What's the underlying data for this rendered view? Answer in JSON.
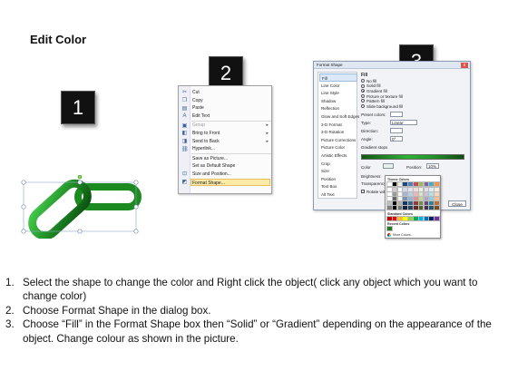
{
  "title": "Edit Color",
  "badges": [
    "1",
    "2",
    "3"
  ],
  "context_menu": {
    "items": [
      {
        "label": "Cut",
        "icon": "scissors-icon",
        "glyph": "✂"
      },
      {
        "label": "Copy",
        "icon": "copy-icon",
        "glyph": "❐"
      },
      {
        "label": "Paste",
        "icon": "paste-icon",
        "glyph": "▤"
      },
      {
        "label": "Edit Text",
        "icon": "edit-text-icon",
        "glyph": "A"
      },
      {
        "label": "Group",
        "icon": "group-icon",
        "glyph": "▣",
        "disabled": true,
        "submenu": true
      },
      {
        "label": "Bring to Front",
        "icon": "bring-front-icon",
        "glyph": "◧",
        "submenu": true
      },
      {
        "label": "Send to Back",
        "icon": "send-back-icon",
        "glyph": "◨",
        "submenu": true
      },
      {
        "label": "Hyperlink...",
        "icon": "hyperlink-icon",
        "glyph": "⛓"
      },
      {
        "label": "Save as Picture...",
        "icon": "",
        "glyph": ""
      },
      {
        "label": "Set as Default Shape",
        "icon": "",
        "glyph": ""
      },
      {
        "label": "Size and Position...",
        "icon": "size-position-icon",
        "glyph": "⊡"
      },
      {
        "label": "Format Shape...",
        "icon": "format-shape-icon",
        "glyph": "◩",
        "highlighted": true
      }
    ]
  },
  "dialog": {
    "title": "Format Shape",
    "close": "x",
    "nav": [
      "Fill",
      "Line Color",
      "Line Style",
      "Shadow",
      "Reflection",
      "Glow and Soft Edges",
      "3-D Format",
      "3-D Rotation",
      "Picture Corrections",
      "Picture Color",
      "Artistic Effects",
      "Crop",
      "Size",
      "Position",
      "Text Box",
      "Alt Text"
    ],
    "section": "Fill",
    "fill_options": [
      "No fill",
      "Solid fill",
      "Gradient fill",
      "Picture or texture fill",
      "Pattern fill",
      "Slide background fill"
    ],
    "selected_fill": "Gradient fill",
    "fields": {
      "preset": "Preset colors:",
      "type": "Type:",
      "type_value": "Linear",
      "direction": "Direction:",
      "angle": "Angle:",
      "angle_value": "0°",
      "gradient_stops": "Gradient stops",
      "color": "Color",
      "position": "Position:",
      "position_value": "10%",
      "brightness": "Brightness:",
      "transparency": "Transparency:",
      "rotate": "Rotate with shape"
    },
    "close_button": "Close"
  },
  "palette": {
    "theme_header": "Theme Colors",
    "standard_header": "Standard Colors",
    "recent_header": "Recent Colors",
    "more": "More Colors...",
    "theme_top": [
      "#ffffff",
      "#000000",
      "#eeece1",
      "#1f497d",
      "#4f81bd",
      "#c0504d",
      "#9bbb59",
      "#8064a2",
      "#4bacc6",
      "#f79646"
    ],
    "standard": [
      "#c00000",
      "#ff0000",
      "#ffc000",
      "#ffff00",
      "#92d050",
      "#00b050",
      "#00b0f0",
      "#0070c0",
      "#002060",
      "#7030a0"
    ],
    "recent": [
      "#1e7a22"
    ]
  },
  "instructions": [
    {
      "num": "1.",
      "text": "Select the shape to change the color and Right click the object( click any object which you want to change color)"
    },
    {
      "num": "2.",
      "text": "Choose Format Shape in the dialog box."
    },
    {
      "num": "3.",
      "text": "Choose “Fill” in the Format Shape box then “Solid” or “Gradient” depending on the appearance of the object. Change colour as shown in the picture."
    }
  ]
}
